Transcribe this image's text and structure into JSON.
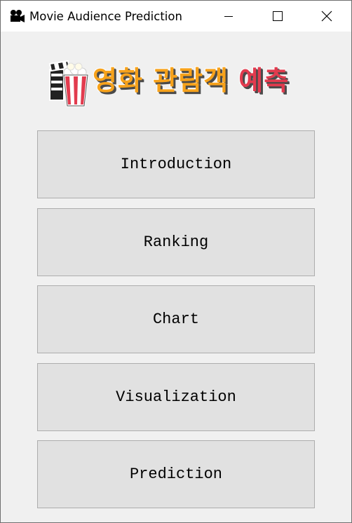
{
  "window": {
    "title": "Movie Audience Prediction",
    "icon": "movie-camera-icon",
    "controls": [
      "minimize-icon",
      "maximize-icon",
      "close-icon"
    ]
  },
  "banner": {
    "text_part1": "영화 관람객",
    "text_part2": " 예측",
    "icon": "popcorn-clapperboard-icon",
    "colors": {
      "orange": "#f7a21b",
      "red": "#e23b4e"
    }
  },
  "menu": {
    "buttons": [
      {
        "label": "Introduction"
      },
      {
        "label": "Ranking"
      },
      {
        "label": "Chart"
      },
      {
        "label": "Visualization"
      },
      {
        "label": "Prediction"
      }
    ]
  }
}
